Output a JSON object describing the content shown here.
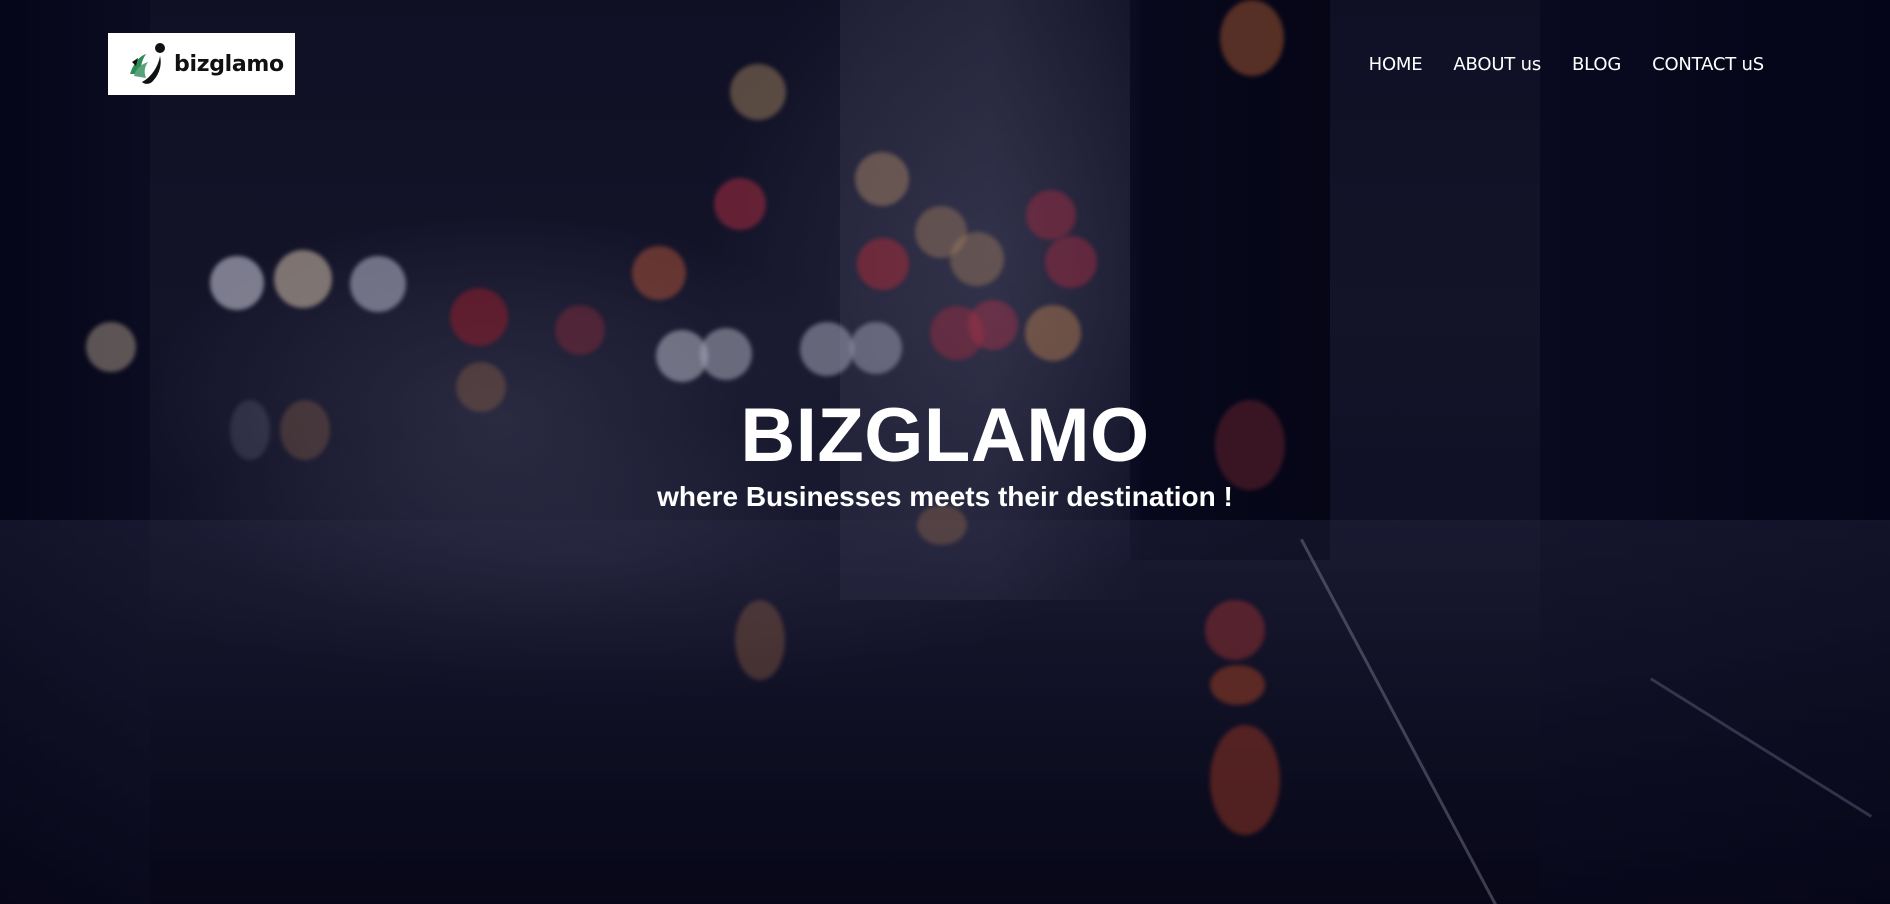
{
  "logo": {
    "text": "bizglamo",
    "icon": "bizglamo-logo-icon",
    "accent_color": "#2e8b57"
  },
  "nav": {
    "items": [
      {
        "label": "HOME"
      },
      {
        "label": "ABOUT us"
      },
      {
        "label": "BLOG"
      },
      {
        "label": "CONTACT uS"
      }
    ]
  },
  "hero": {
    "title": "BIZGLAMO",
    "subtitle": "where Businesses meets their destination !",
    "background": "blurred-city-street-at-night"
  },
  "colors": {
    "text": "#ffffff",
    "background_dark": "#0a0a18"
  }
}
